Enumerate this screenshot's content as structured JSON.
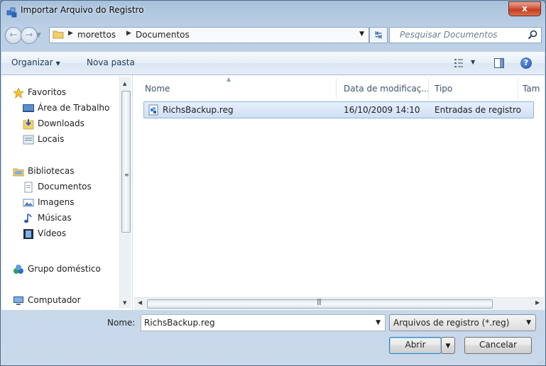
{
  "window": {
    "title": "Importar Arquivo do Registro",
    "close_label": "x"
  },
  "address": {
    "crumbs": [
      "morettos",
      "Documentos"
    ],
    "search_placeholder": "Pesquisar Documentos"
  },
  "toolbar": {
    "organize": "Organizar",
    "new_folder": "Nova pasta",
    "help": "?"
  },
  "nav": {
    "items": [
      {
        "label": "Favoritos",
        "icon": "star-icon"
      },
      {
        "label": "Área de Trabalho",
        "icon": "desktop-icon"
      },
      {
        "label": "Downloads",
        "icon": "downloads-icon"
      },
      {
        "label": "Locais",
        "icon": "recent-places-icon"
      },
      {
        "label": "Bibliotecas",
        "icon": "libraries-icon"
      },
      {
        "label": "Documentos",
        "icon": "documents-icon"
      },
      {
        "label": "Imagens",
        "icon": "pictures-icon"
      },
      {
        "label": "Músicas",
        "icon": "music-icon"
      },
      {
        "label": "Vídeos",
        "icon": "videos-icon"
      },
      {
        "label": "Grupo doméstico",
        "icon": "homegroup-icon"
      },
      {
        "label": "Computador",
        "icon": "computer-icon"
      }
    ]
  },
  "files": {
    "columns": [
      "Nome",
      "Data de modificaç...",
      "Tipo",
      "Tam"
    ],
    "rows": [
      {
        "name": "RichsBackup.reg",
        "modified": "16/10/2009 14:10",
        "type": "Entradas de registro"
      }
    ]
  },
  "footer": {
    "name_label": "Nome:",
    "name_value": "RichsBackup.reg",
    "filter_value": "Arquivos de registro (*.reg)",
    "open_label": "Abrir",
    "cancel_label": "Cancelar"
  },
  "colors": {
    "selection": "#cfe0f4",
    "chrome": "#bcd0e6",
    "close": "#c33b1f"
  }
}
